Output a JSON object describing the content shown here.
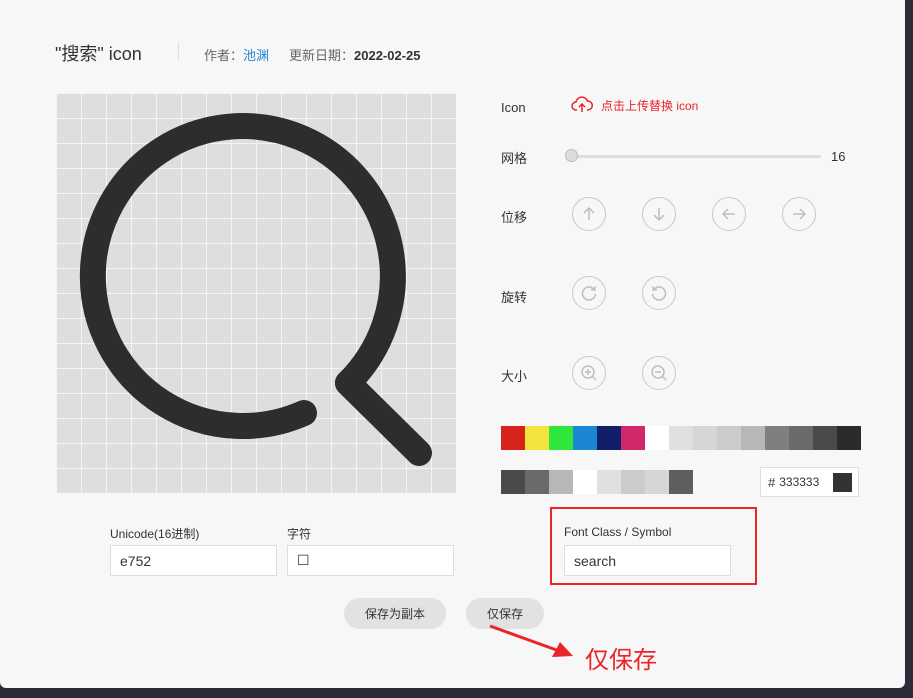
{
  "header": {
    "title": "\"搜索\" icon",
    "author_label": "作者：",
    "author_name": "池渊",
    "updated_label": "更新日期：",
    "updated_date": "2022-02-25"
  },
  "controls": {
    "icon_label": "Icon",
    "upload_text": "点击上传替换 icon",
    "grid_label": "网格",
    "grid_value": "16",
    "move_label": "位移",
    "rotate_label": "旋转",
    "size_label": "大小"
  },
  "colors": {
    "row1": [
      "#d6231c",
      "#f2e33d",
      "#2fe63d",
      "#1b87d4",
      "#131e6b",
      "#d1286a",
      "#ffffff",
      "#e0e0e0",
      "#d6d6d6",
      "#cbcbcb",
      "#b7b7b7",
      "#7f7f7f",
      "#6a6a6a",
      "#4a4a4a",
      "#2b2b2b"
    ],
    "row2": [
      "#4a4a4a",
      "#6a6a6a",
      "#b7b7b7",
      "#ffffff",
      "#e0e0e0",
      "#cbcbcb",
      "#d6d6d6",
      "#5e5e5e"
    ],
    "hash": "#",
    "hex_value": "333333",
    "current": "#333333"
  },
  "fields": {
    "unicode_label": "Unicode(16进制)",
    "unicode_value": "e752",
    "char_label": "字符",
    "char_value": "☐",
    "font_class_label": "Font Class / Symbol",
    "font_class_value": "search"
  },
  "buttons": {
    "save_copy": "保存为副本",
    "save_only": "仅保存"
  },
  "annotation": {
    "text": "仅保存",
    "color": "#e8262a"
  }
}
